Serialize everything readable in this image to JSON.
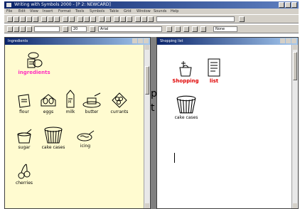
{
  "window": {
    "title": "Writing with Symbols 2000 - [P 2: NEWCARD]"
  },
  "menubar": [
    "File",
    "Edit",
    "View",
    "Insert",
    "Format",
    "Tools",
    "Symbols",
    "Table",
    "Grid",
    "Window",
    "Sounds",
    "Help"
  ],
  "toolbar2": {
    "search_box_value": ""
  },
  "toolbar3": {
    "font_value": "Arial",
    "size_value": "20",
    "zoom_value": "None"
  },
  "left_window": {
    "title": "Ingredients",
    "header_symbol": {
      "label": "ingredients",
      "icon": "ingredients-icon"
    },
    "rows": [
      [
        {
          "label": "flour",
          "icon": "flour-icon"
        },
        {
          "label": "eggs",
          "icon": "eggs-icon"
        },
        {
          "label": "milk",
          "icon": "milk-icon"
        },
        {
          "label": "butter",
          "icon": "butter-icon"
        },
        {
          "label": "currants",
          "icon": "currants-icon"
        }
      ],
      [
        {
          "label": "sugar",
          "icon": "sugar-icon"
        },
        {
          "label": "cake cases",
          "icon": "cake-cases-icon"
        },
        {
          "label": "icing",
          "icon": "icing-icon"
        }
      ],
      [
        {
          "label": "cherries",
          "icon": "cherries-icon"
        }
      ]
    ]
  },
  "right_window": {
    "title": "Shopping list",
    "words": [
      {
        "label": "Shopping",
        "icon": "shopping-icon"
      },
      {
        "label": "list",
        "icon": "list-icon"
      }
    ],
    "items": [
      {
        "label": "cake cases",
        "icon": "cake-cases-icon"
      }
    ]
  },
  "side_text": {
    "line1": "p",
    "line2": "t"
  },
  "colors": {
    "left_bg": "#fffbd0",
    "header_label": "#ff2fbf",
    "words_label": "#e00000"
  }
}
